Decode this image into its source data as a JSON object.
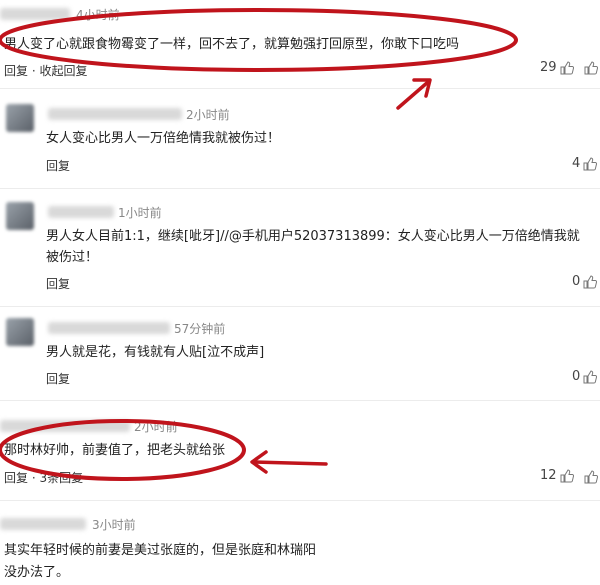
{
  "comments": [
    {
      "time": "4小时前",
      "text": "男人变了心就跟食物霉变了一样，回不去了，就算勉强打回原型，你敢下口吃吗",
      "actions": "回复 · 收起回复",
      "likes": "29"
    },
    {
      "time": "2小时前",
      "text": "女人变心比男人一万倍绝情我就被伤过！",
      "actions": "回复",
      "likes": "4"
    },
    {
      "time": "1小时前",
      "text": "男人女人目前1:1，继续[呲牙]//@手机用户52037313899：女人变心比男人一万倍绝情我就被伤过！",
      "actions": "回复",
      "likes": "0"
    },
    {
      "time": "57分钟前",
      "text": "男人就是花，有钱就有人贴[泣不成声]",
      "actions": "回复",
      "likes": "0"
    },
    {
      "time": "2小时前",
      "text": "那时林好帅，前妻值了，把老头就给张",
      "actions": "回复 · 3条回复",
      "likes": "12"
    },
    {
      "time": "3小时前",
      "text": "其实年轻时候的前妻是美过张庭的，但是张庭和林瑞阳",
      "text2": "没办法了。"
    }
  ],
  "colors": {
    "annotation": "#c0141c"
  }
}
